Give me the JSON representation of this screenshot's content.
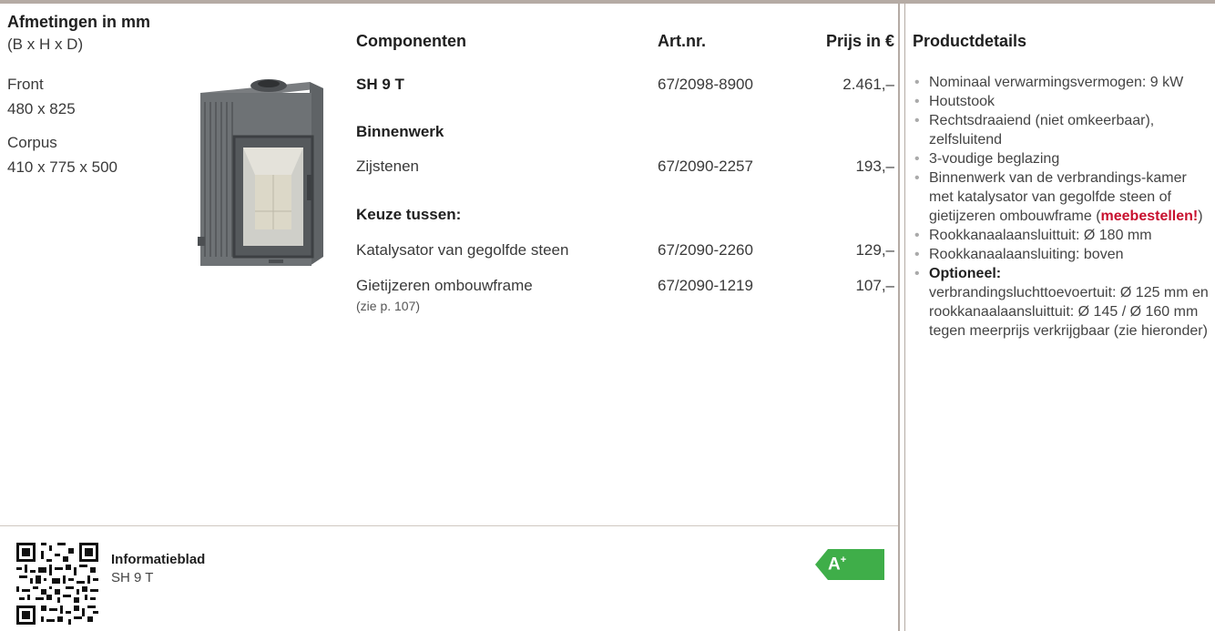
{
  "header": {
    "dimensions_title": "Afmetingen in mm",
    "dimensions_sub": "(B x H x D)",
    "components": "Componenten",
    "artnr": "Art.nr.",
    "price": "Prijs in €",
    "details": "Productdetails"
  },
  "dimensions": {
    "front_label": "Front",
    "front_value": "480 x 825",
    "corpus_label": "Corpus",
    "corpus_value": "410 x 775 x 500"
  },
  "rows": {
    "main": {
      "name": "SH 9 T",
      "artnr": "67/2098-8900",
      "price": "2.461,–"
    },
    "binnenwerk_heading": "Binnenwerk",
    "zijstenen": {
      "name": "Zijstenen",
      "artnr": "67/2090-2257",
      "price": "193,–"
    },
    "keuze_heading": "Keuze tussen:",
    "katalysator": {
      "name": "Katalysator van gegolfde steen",
      "artnr": "67/2090-2260",
      "price": "129,–"
    },
    "ombouwframe": {
      "name": "Gietijzeren ombouwframe",
      "note": "(zie p. 107)",
      "artnr": "67/2090-1219",
      "price": "107,–"
    }
  },
  "details": {
    "bullet": "•",
    "d1": "Nominaal verwarmingsvermogen: 9 kW",
    "d2": "Houtstook",
    "d3": "Rechtsdraaiend (niet omkeerbaar), zelfsluitend",
    "d4": "3-voudige beglazing",
    "d5_pre": "Binnenwerk van de verbrandings-kamer met katalysator van gegolfde steen of gietijzeren ombouwframe (",
    "d5_red": "meebestellen!",
    "d5_post": ")",
    "d6": "Rookkanaalaansluittuit: Ø 180 mm",
    "d7": "Rookkanaalaansluiting: boven",
    "d8_bold": "Optioneel:",
    "d8_rest": "verbrandingsluchttoevoertuit: Ø 125 mm en rookkanaalaansluittuit: Ø 145 / Ø 160 mm tegen meerprijs verkrijgbaar (zie hieronder)"
  },
  "footer": {
    "info_title": "Informatieblad",
    "info_sub": "SH 9 T",
    "energy_label": "A",
    "energy_sup": "+",
    "energy_color": "#3fae49"
  }
}
